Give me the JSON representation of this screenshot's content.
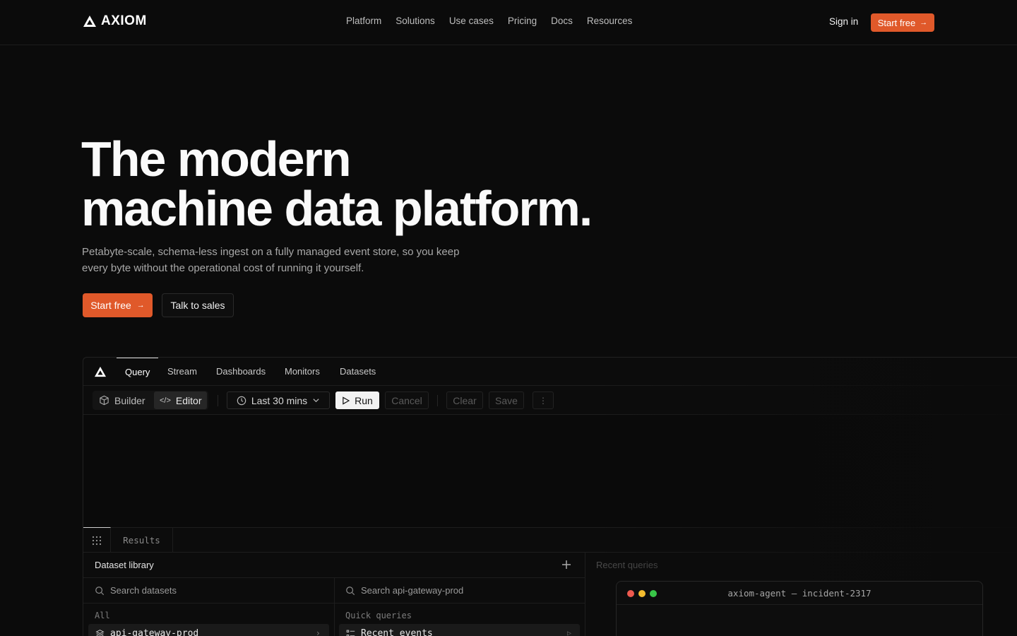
{
  "nav": {
    "brand": "AXIOM",
    "links": [
      "Platform",
      "Solutions",
      "Use cases",
      "Pricing",
      "Docs",
      "Resources"
    ],
    "signin": "Sign in",
    "cta": "Start free"
  },
  "hero": {
    "title_line1": "The modern",
    "title_line2": "machine data platform.",
    "subtitle": "Petabyte-scale, schema-less ingest on a fully managed event store, so you keep every byte without the operational cost of running it yourself.",
    "primary_cta": "Start free",
    "secondary_cta": "Talk to sales"
  },
  "app": {
    "tabs": [
      "Query",
      "Stream",
      "Dashboards",
      "Monitors",
      "Datasets"
    ],
    "active_tab": "Query",
    "toolbar": {
      "builder": "Builder",
      "editor": "Editor",
      "time_range": "Last 30 mins",
      "run": "Run",
      "cancel": "Cancel",
      "clear": "Clear",
      "save": "Save"
    },
    "results_tab": "Results",
    "library": {
      "title": "Dataset library",
      "search_placeholder": "Search datasets",
      "section": "All",
      "item": "api-gateway-prod"
    },
    "queries": {
      "search_placeholder": "Search api-gateway-prod",
      "section": "Quick queries",
      "item": "Recent events"
    },
    "recent_label": "Recent queries"
  },
  "terminal": {
    "title": "axiom-agent — incident-2317"
  },
  "colors": {
    "accent": "#e0592a",
    "background": "#0b0b0b"
  }
}
